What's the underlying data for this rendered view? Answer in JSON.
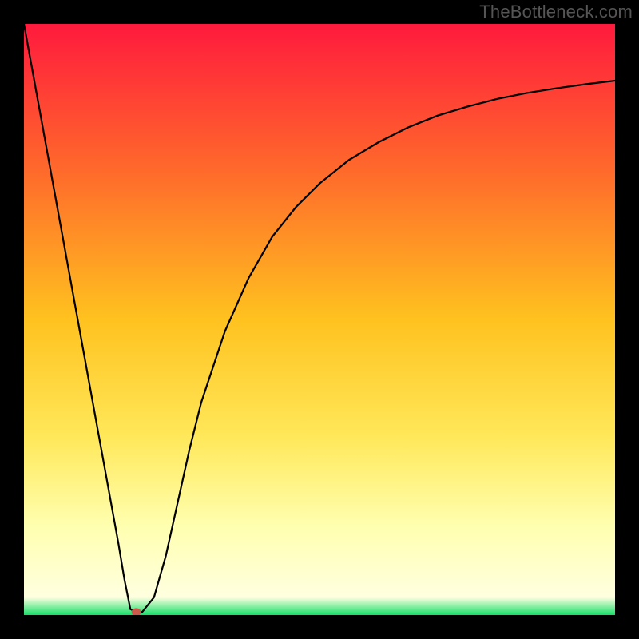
{
  "watermark": "TheBottleneck.com",
  "chart_data": {
    "type": "line",
    "title": "",
    "xlabel": "",
    "ylabel": "",
    "xlim": [
      0,
      100
    ],
    "ylim": [
      0,
      100
    ],
    "grid": false,
    "legend": false,
    "background_gradient": {
      "description": "vertical gradient red->orange->yellow->pale-yellow->green, top to bottom",
      "stops": [
        {
          "offset": 0.0,
          "color": "#ff1a3d"
        },
        {
          "offset": 0.25,
          "color": "#ff6a2b"
        },
        {
          "offset": 0.5,
          "color": "#ffc21f"
        },
        {
          "offset": 0.7,
          "color": "#ffe85a"
        },
        {
          "offset": 0.85,
          "color": "#ffffb0"
        },
        {
          "offset": 0.97,
          "color": "#ffffe0"
        },
        {
          "offset": 1.0,
          "color": "#16e06a"
        }
      ]
    },
    "series": [
      {
        "name": "curve",
        "color": "#000000",
        "x": [
          0,
          2,
          4,
          6,
          8,
          10,
          12,
          14,
          16,
          17,
          18,
          19,
          20,
          22,
          24,
          26,
          28,
          30,
          34,
          38,
          42,
          46,
          50,
          55,
          60,
          65,
          70,
          75,
          80,
          85,
          90,
          95,
          100
        ],
        "y": [
          100,
          89,
          78,
          67,
          56,
          45,
          34,
          23,
          12,
          6,
          1,
          0.5,
          0.5,
          3,
          10,
          19,
          28,
          36,
          48,
          57,
          64,
          69,
          73,
          77,
          80,
          82.5,
          84.5,
          86,
          87.3,
          88.3,
          89.1,
          89.8,
          90.4
        ]
      }
    ],
    "marker": {
      "name": "min-point",
      "x": 19,
      "y": 0.5,
      "color": "#cc5a4a",
      "radius_px": 6
    }
  }
}
